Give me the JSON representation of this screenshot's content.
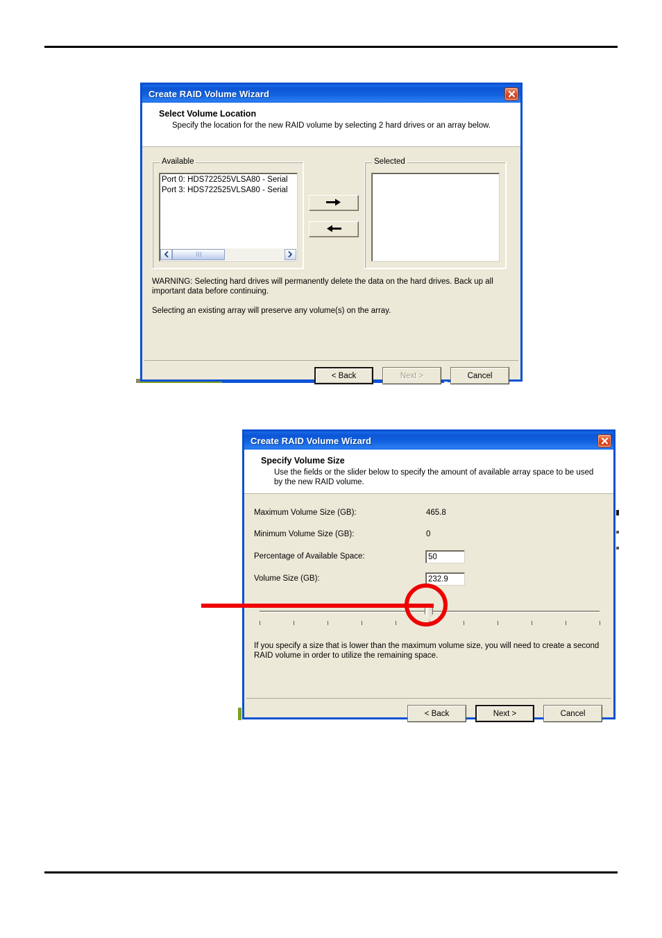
{
  "document": {
    "page_rules": [
      "top-rule",
      "bottom-rule"
    ]
  },
  "dialog_location": {
    "title": "Create RAID Volume Wizard",
    "close_icon": "close-icon",
    "heading": "Select Volume Location",
    "description": "Specify the location for the new RAID volume by selecting 2 hard drives or an array below.",
    "available_group_label": "Available",
    "selected_group_label": "Selected",
    "available_items": [
      "Port 0: HDS722525VLSA80 - Serial",
      "Port 3: HDS722525VLSA80 - Serial"
    ],
    "selected_items": [],
    "move_right_icon": "arrow-right-icon",
    "move_left_icon": "arrow-left-icon",
    "scroll_left_icon": "chevron-left-icon",
    "scroll_right_icon": "chevron-right-icon",
    "warning_text": "WARNING: Selecting hard drives will permanently delete the data on the hard drives. Back up all important data before continuing.",
    "note_text": "Selecting an existing array will preserve any volume(s) on the array.",
    "buttons": {
      "back": "< Back",
      "next": "Next >",
      "cancel": "Cancel"
    }
  },
  "dialog_size": {
    "title": "Create RAID Volume Wizard",
    "close_icon": "close-icon",
    "heading": "Specify Volume Size",
    "description": "Use the fields or the slider below to specify the amount of available array space to be used by the new RAID volume.",
    "fields": [
      {
        "label": "Maximum Volume Size (GB):",
        "value": "465.8",
        "type": "static"
      },
      {
        "label": "Minimum Volume Size (GB):",
        "value": "0",
        "type": "static"
      },
      {
        "label": "Percentage of Available Space:",
        "value": "50",
        "type": "input"
      },
      {
        "label": "Volume Size (GB):",
        "value": "232.9",
        "type": "input"
      }
    ],
    "slider": {
      "position_percent": 50,
      "tick_count": 11
    },
    "note_text": "If you specify a size that is lower than the maximum volume size, you will need to create a second RAID volume in order to utilize the remaining space.",
    "buttons": {
      "back": "< Back",
      "next": "Next >",
      "cancel": "Cancel"
    }
  },
  "annotation": {
    "color": "#ee0000",
    "shapes": [
      "pointer-line",
      "highlight-circle"
    ],
    "target": "slider-thumb"
  }
}
